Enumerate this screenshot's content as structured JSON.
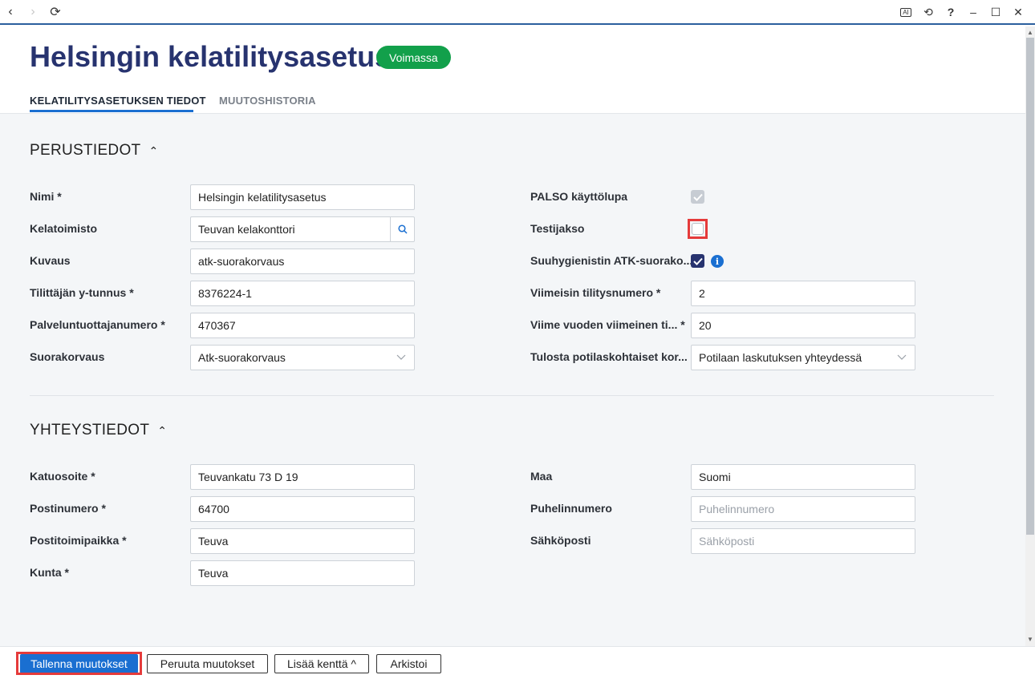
{
  "toolbar": {
    "back": "‹",
    "forward": "›",
    "reload": "⟳",
    "ai": "AI",
    "history": "⟲",
    "help": "?",
    "minimize": "–",
    "maximize": "☐",
    "close": "✕"
  },
  "header": {
    "title": "Helsingin kelatilitysasetus",
    "status_badge": "Voimassa",
    "tabs": [
      {
        "label": "KELATILITYSASETUKSEN TIEDOT",
        "active": true
      },
      {
        "label": "MUUTOSHISTORIA",
        "active": false
      }
    ]
  },
  "perustiedot": {
    "title": "PERUSTIEDOT",
    "chevron": "⌃",
    "left_fields": [
      {
        "label": "Nimi *",
        "value": "Helsingin kelatilitysasetus"
      },
      {
        "label": "Kelatoimisto",
        "value": "Teuvan kelakonttori"
      },
      {
        "label": "Kuvaus",
        "value": "atk-suorakorvaus"
      },
      {
        "label": "Tilittäjän y-tunnus *",
        "value": "8376224-1"
      },
      {
        "label": "Palveluntuottajanumero *",
        "value": "470367"
      },
      {
        "label": "Suorakorvaus",
        "value": "Atk-suorakorvaus"
      }
    ],
    "right_fields": [
      {
        "label": "PALSO käyttölupa",
        "checked": true,
        "disabled": true
      },
      {
        "label": "Testijakso",
        "checked": false
      },
      {
        "label": "Suuhygienistin ATK-suorako...",
        "checked": true,
        "info": "i"
      },
      {
        "label": "Viimeisin tilitysnumero *",
        "value": "2"
      },
      {
        "label": "Viime vuoden viimeinen ti... *",
        "value": "20"
      },
      {
        "label": "Tulosta potilaskohtaiset kor...",
        "value": "Potilaan laskutuksen yhteydessä"
      }
    ]
  },
  "yhteystiedot": {
    "title": "YHTEYSTIEDOT",
    "chevron": "⌃",
    "left_fields": [
      {
        "label": "Katuosoite *",
        "value": "Teuvankatu 73 D 19"
      },
      {
        "label": "Postinumero *",
        "value": "64700"
      },
      {
        "label": "Postitoimipaikka *",
        "value": "Teuva"
      },
      {
        "label": "Kunta *",
        "value": "Teuva"
      }
    ],
    "right_fields": [
      {
        "label": "Maa",
        "value": "Suomi"
      },
      {
        "label": "Puhelinnumero",
        "placeholder": "Puhelinnumero"
      },
      {
        "label": "Sähköposti",
        "placeholder": "Sähköposti"
      }
    ]
  },
  "footer": {
    "save": "Tallenna muutokset",
    "cancel": "Peruuta muutokset",
    "add_field": "Lisää kenttä ^",
    "archive": "Arkistoi"
  },
  "colors": {
    "accent": "#1a6fd1",
    "title": "#27336f",
    "badge": "#12a04b",
    "highlight": "#e53b3b"
  }
}
